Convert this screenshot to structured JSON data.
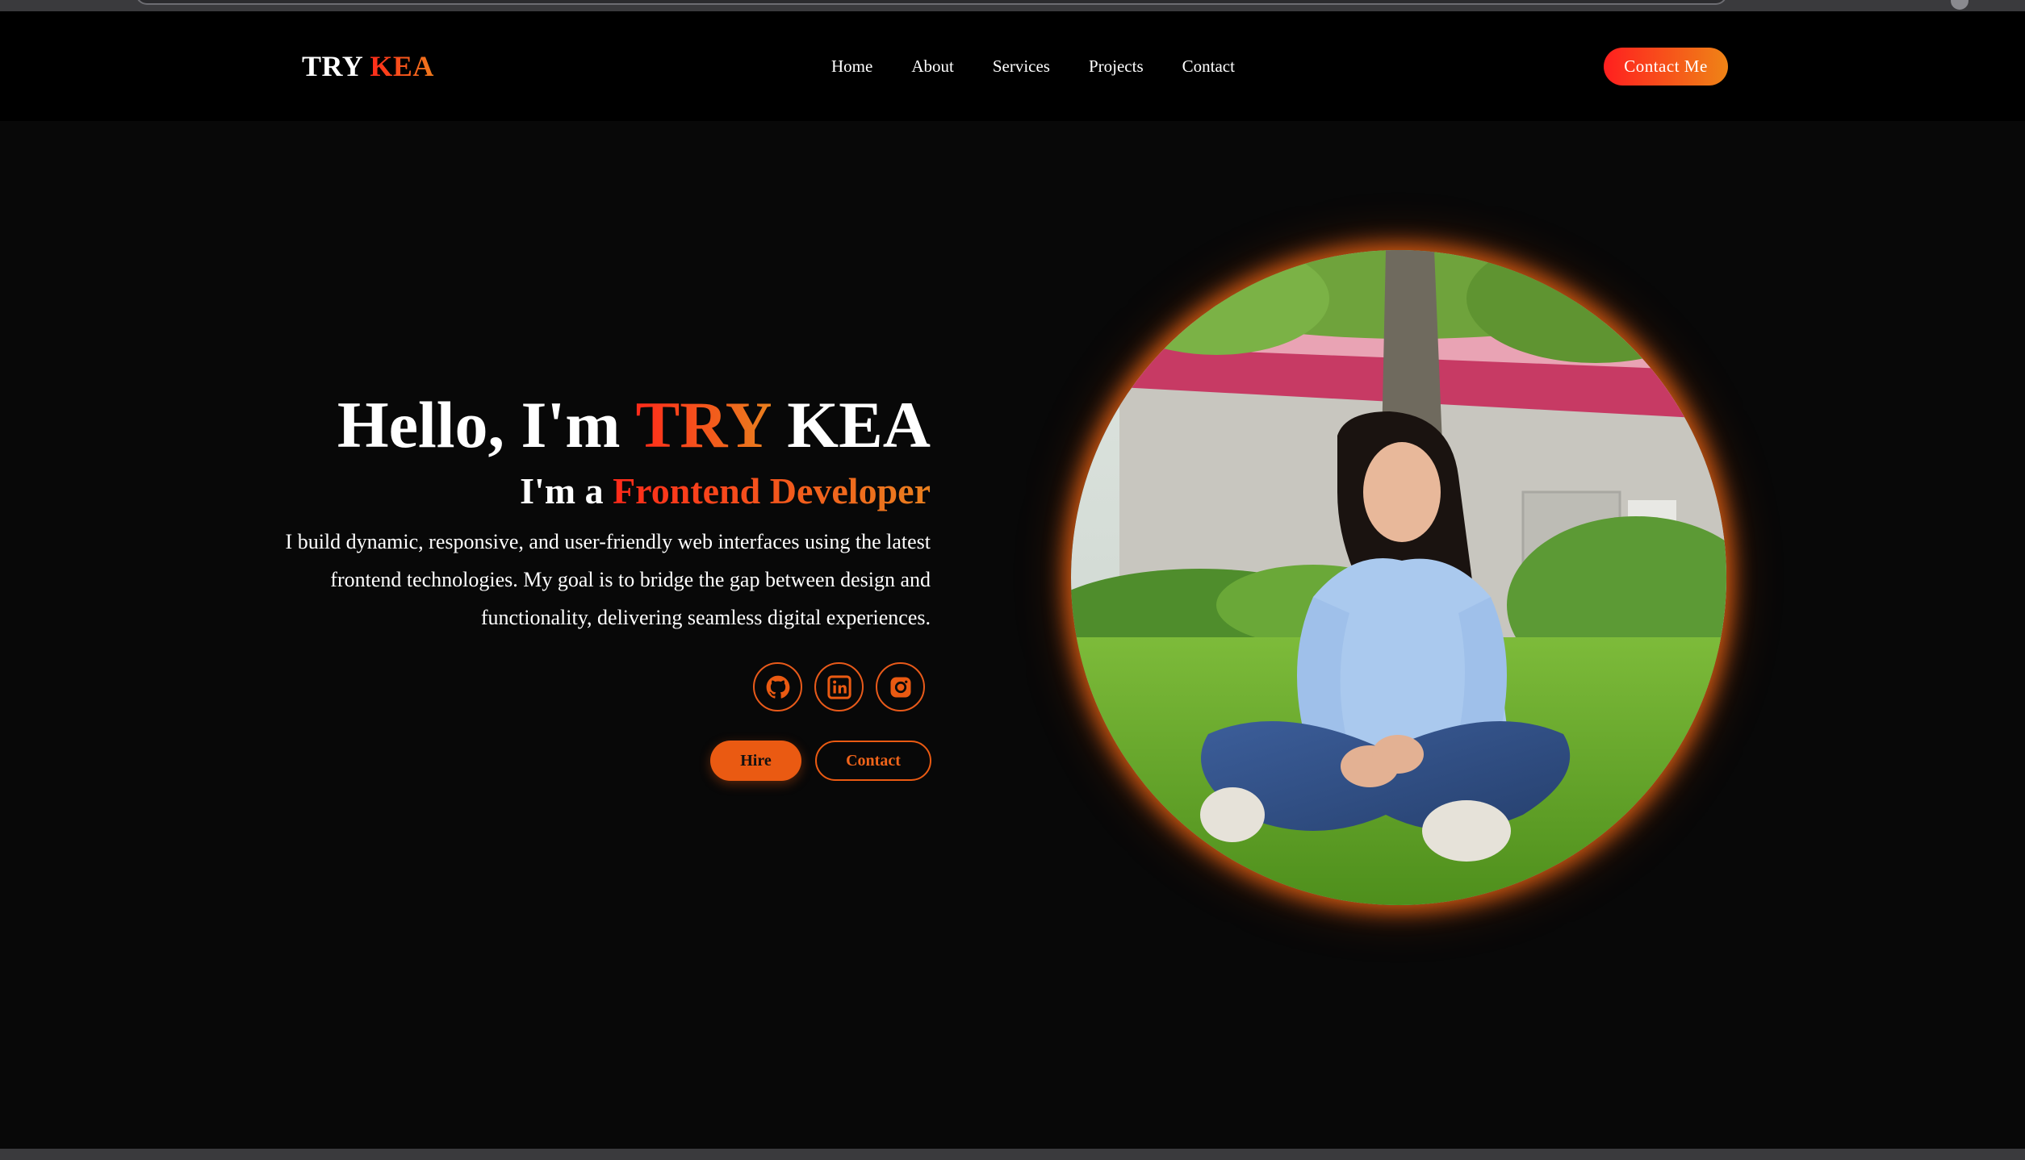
{
  "nav": {
    "logo_first": "TRY",
    "logo_second": "KEA",
    "links": [
      "Home",
      "About",
      "Services",
      "Projects",
      "Contact"
    ],
    "cta_label": "Contact Me"
  },
  "hero": {
    "greeting": "Hello, I'm",
    "name_first": "TRY",
    "name_second": "KEA",
    "role_prefix": "I'm a",
    "role": "Frontend Developer",
    "description": "I build dynamic, responsive, and user-friendly web interfaces using the latest frontend technologies. My goal is to bridge the gap between design and functionality, delivering seamless digital experiences.",
    "socials": [
      "github-icon",
      "linkedin-icon",
      "instagram-icon"
    ],
    "hire_label": "Hire",
    "contact_label": "Contact"
  },
  "colors": {
    "background": "#080808",
    "navbar": "#000000",
    "accent_start": "#ff2a1a",
    "accent_end": "#ef8416",
    "accent_solid": "#ea5a12"
  }
}
